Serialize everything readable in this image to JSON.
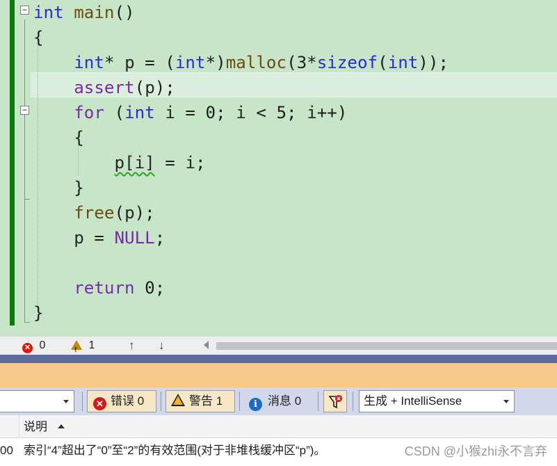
{
  "editor": {
    "lines": [
      [
        {
          "t": "int",
          "c": "kw"
        },
        {
          "t": " ",
          "c": "pl"
        },
        {
          "t": "main",
          "c": "fn"
        },
        {
          "t": "()",
          "c": "pl"
        }
      ],
      [
        {
          "t": "{",
          "c": "pl"
        }
      ],
      [
        {
          "t": "    ",
          "c": "pl"
        },
        {
          "t": "int",
          "c": "kw"
        },
        {
          "t": "* ",
          "c": "pl"
        },
        {
          "t": "p",
          "c": "var"
        },
        {
          "t": " = (",
          "c": "pl"
        },
        {
          "t": "int",
          "c": "kw"
        },
        {
          "t": "*)",
          "c": "pl"
        },
        {
          "t": "malloc",
          "c": "fn"
        },
        {
          "t": "(3*",
          "c": "pl"
        },
        {
          "t": "sizeof",
          "c": "kw"
        },
        {
          "t": "(",
          "c": "pl"
        },
        {
          "t": "int",
          "c": "kw"
        },
        {
          "t": "));",
          "c": "pl"
        }
      ],
      [
        {
          "t": "    ",
          "c": "pl"
        },
        {
          "t": "assert",
          "c": "mac"
        },
        {
          "t": "(",
          "c": "pl"
        },
        {
          "t": "p",
          "c": "var"
        },
        {
          "t": ");",
          "c": "pl"
        }
      ],
      [
        {
          "t": "    ",
          "c": "pl"
        },
        {
          "t": "for",
          "c": "mac"
        },
        {
          "t": " (",
          "c": "pl"
        },
        {
          "t": "int",
          "c": "kw"
        },
        {
          "t": " ",
          "c": "pl"
        },
        {
          "t": "i",
          "c": "var"
        },
        {
          "t": " = 0; ",
          "c": "pl"
        },
        {
          "t": "i",
          "c": "var"
        },
        {
          "t": " < 5; ",
          "c": "pl"
        },
        {
          "t": "i",
          "c": "var"
        },
        {
          "t": "++)",
          "c": "pl"
        }
      ],
      [
        {
          "t": "    {",
          "c": "pl"
        }
      ],
      [
        {
          "t": "        ",
          "c": "pl"
        },
        {
          "t": "p[i]",
          "c": "var squiggle"
        },
        {
          "t": " = ",
          "c": "pl"
        },
        {
          "t": "i",
          "c": "var"
        },
        {
          "t": ";",
          "c": "pl"
        }
      ],
      [
        {
          "t": "    }",
          "c": "pl"
        }
      ],
      [
        {
          "t": "    ",
          "c": "pl"
        },
        {
          "t": "free",
          "c": "fn"
        },
        {
          "t": "(",
          "c": "pl"
        },
        {
          "t": "p",
          "c": "var"
        },
        {
          "t": ");",
          "c": "pl"
        }
      ],
      [
        {
          "t": "    ",
          "c": "pl"
        },
        {
          "t": "p",
          "c": "var"
        },
        {
          "t": " = ",
          "c": "pl"
        },
        {
          "t": "NULL",
          "c": "mac"
        },
        {
          "t": ";",
          "c": "pl"
        }
      ],
      [
        {
          "t": "",
          "c": "pl"
        }
      ],
      [
        {
          "t": "    ",
          "c": "pl"
        },
        {
          "t": "return",
          "c": "mac"
        },
        {
          "t": " 0;",
          "c": "pl"
        }
      ],
      [
        {
          "t": "}",
          "c": "pl"
        }
      ]
    ],
    "fold_minus": "−"
  },
  "status": {
    "errors": "0",
    "warnings": "1",
    "up_arrow": "↑",
    "down_arrow": "↓"
  },
  "toolbar": {
    "errors_label": "错误 0",
    "warnings_label": "警告 1",
    "messages_label": "消息 0",
    "build_filter": "生成 + IntelliSense"
  },
  "list": {
    "header_desc": "说明",
    "row_code": "00",
    "row_desc": "索引“4”超出了“0”至“2”的有效范围(对于非堆栈缓冲区“p”)。"
  },
  "watermark": "CSDN @小猴zhi永不言弃",
  "colors": {
    "editor_bg": "#c7e5c9",
    "change_bar": "#10780e",
    "keyword": "#2b2bd6",
    "macro": "#7a2aa8",
    "function": "#6e4b0e",
    "error": "#d9171b",
    "warning": "#f2b21f"
  }
}
